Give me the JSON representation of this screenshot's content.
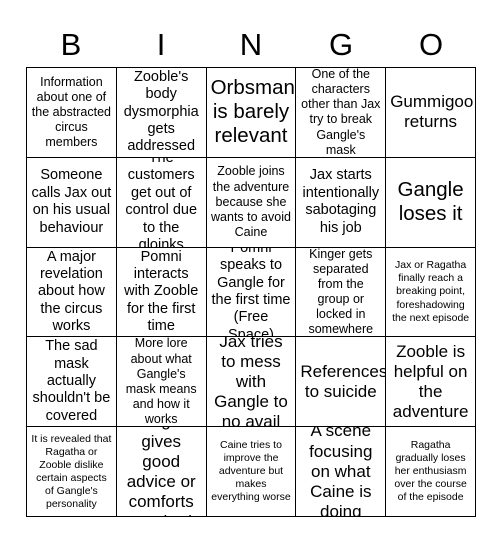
{
  "header": {
    "letters": [
      "B",
      "I",
      "N",
      "G",
      "O"
    ]
  },
  "colors": {
    "background": "#ffffff",
    "grid_line": "#000000",
    "text": "#000000"
  },
  "grid": {
    "rows": 5,
    "columns": 5,
    "cells": [
      {
        "text": "Information about one of the abstracted circus members",
        "size": "sm"
      },
      {
        "text": "Zooble's body dysmorphia gets addressed",
        "size": "md"
      },
      {
        "text": "Orbsman is barely relevant",
        "size": "xl"
      },
      {
        "text": "One of the characters other than Jax try to break Gangle's mask",
        "size": "sm"
      },
      {
        "text": "Gummigoo returns",
        "size": "lg"
      },
      {
        "text": "Someone calls Jax out on his usual behaviour",
        "size": "md"
      },
      {
        "text": "The customers get out of control due to the gloinks",
        "size": "md"
      },
      {
        "text": "Zooble joins the adventure because she wants to avoid Caine",
        "size": "sm"
      },
      {
        "text": "Jax starts intentionally sabotaging his job",
        "size": "md"
      },
      {
        "text": "Gangle loses it",
        "size": "xl"
      },
      {
        "text": "A major revelation about how the circus works",
        "size": "md"
      },
      {
        "text": "Pomni interacts with Zooble for the first time",
        "size": "md"
      },
      {
        "text": "Pomni speaks to Gangle for the first time (Free Space)",
        "size": "md"
      },
      {
        "text": "Kinger gets separated from the group or locked in somewhere",
        "size": "sm"
      },
      {
        "text": "Jax or Ragatha finally reach a breaking point, foreshadowing the next episode",
        "size": "xs"
      },
      {
        "text": "The sad mask actually shouldn't be covered",
        "size": "md"
      },
      {
        "text": "More lore about what Gangle's mask means and how it works",
        "size": "sm"
      },
      {
        "text": "Jax tries to mess with Gangle to no avail",
        "size": "lg"
      },
      {
        "text": "References to suicide",
        "size": "lg"
      },
      {
        "text": "Zooble is helpful on the adventure",
        "size": "lg"
      },
      {
        "text": "It is revealed that Ragatha or Zooble dislike certain aspects of Gangle's personality",
        "size": "xs"
      },
      {
        "text": "Kinger gives good advice or comforts somebody",
        "size": "lg"
      },
      {
        "text": "Caine tries to improve the adventure but makes everything worse",
        "size": "xs"
      },
      {
        "text": "A scene focusing on what Caine is doing",
        "size": "lg"
      },
      {
        "text": "Ragatha gradually loses her enthusiasm over the course of the episode",
        "size": "xs"
      }
    ]
  }
}
